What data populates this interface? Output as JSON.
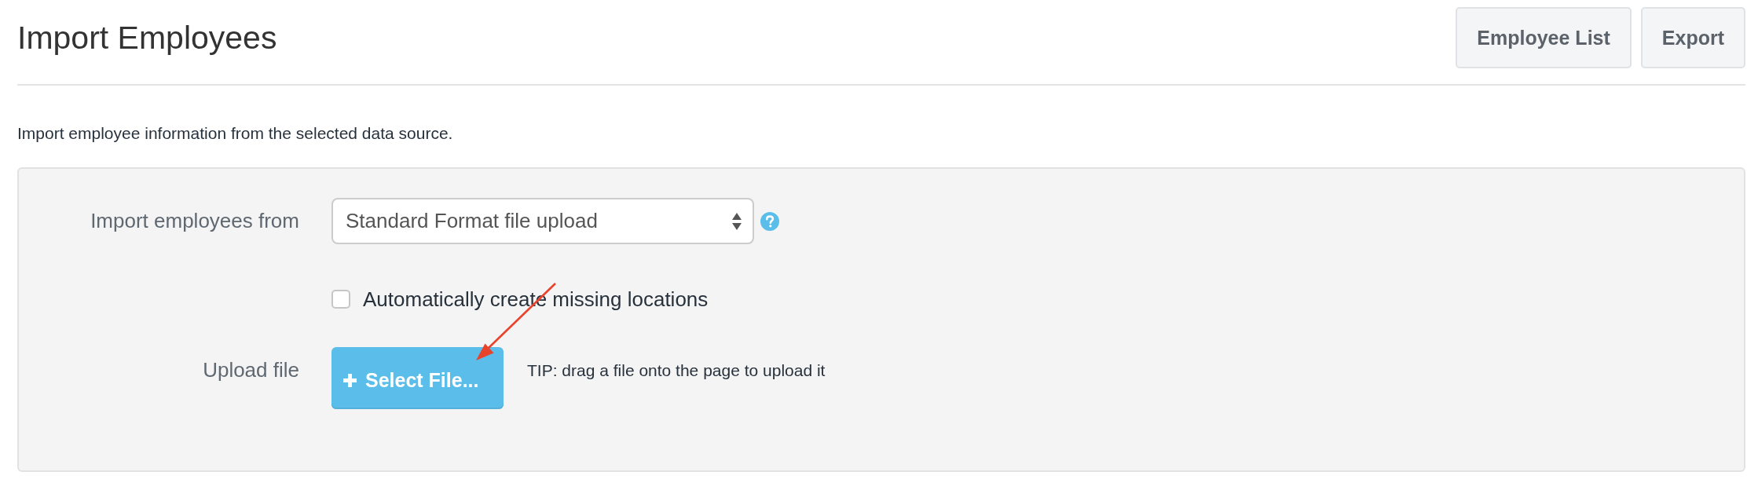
{
  "page": {
    "title": "Import Employees",
    "buttons": [
      {
        "label": "Employee List"
      },
      {
        "label": "Export"
      }
    ],
    "description": "Import employee information from the selected data source."
  },
  "form": {
    "rows": [
      {
        "kind": "select",
        "label": "Import employees from",
        "value": "Standard Format file upload"
      },
      {
        "kind": "checkbox",
        "label": "Automatically create missing locations",
        "checked": false
      },
      {
        "kind": "upload",
        "label": "Upload file",
        "button": "Select File...",
        "tip": "TIP: drag a file onto the page to upload it"
      }
    ]
  }
}
